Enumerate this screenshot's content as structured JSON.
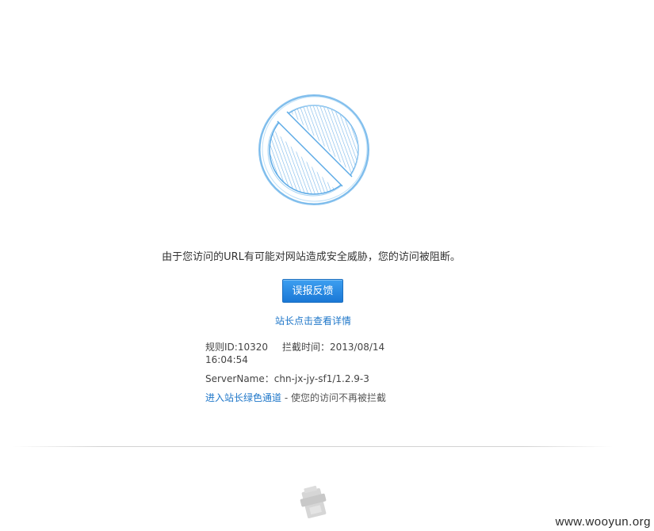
{
  "message": "由于您访问的URL有可能对网站造成安全威胁，您的访问被阻断。",
  "report_button": "误报反馈",
  "details_link": "站长点击查看详情",
  "info": {
    "rule_id": "规则ID:10320",
    "intercept_time": "拦截时间：2013/08/14 16:04:54",
    "server_name": "ServerName：chn-jx-jy-sf1/1.2.9-3",
    "green_channel_link": "进入站长绿色通道",
    "green_channel_desc": " - 使您的访问不再被拦截"
  },
  "watermark": "www.wooyun.org",
  "colors": {
    "accent": "#1f77c9",
    "icon_blue": "#5aa9e6",
    "button_top": "#3d9ff0",
    "button_bottom": "#1a78d6"
  },
  "icons": {
    "block": "prohibited-sign-icon",
    "footer": "firewall-logo-icon"
  }
}
